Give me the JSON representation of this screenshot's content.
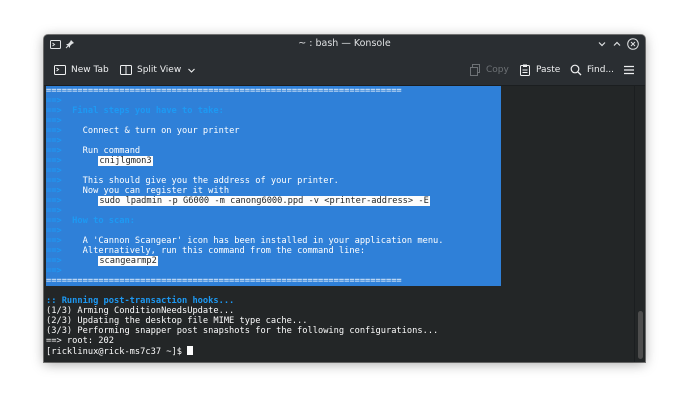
{
  "window": {
    "title": "~ : bash — Konsole"
  },
  "toolbar": {
    "new_tab": "New Tab",
    "split_view": "Split View",
    "copy": "Copy",
    "paste": "Paste",
    "find": "Find..."
  },
  "terminal": {
    "arrow": "==>",
    "banner_rule": "====================================================================",
    "lines": {
      "final_steps": "Final steps you have to take:",
      "connect": "Connect & turn on your printer",
      "run_command": "Run command",
      "cmd1": "cnijlgmon3",
      "should_give": "This should give you the address of your printer.",
      "now_register": "Now you can register it with",
      "cmd2": "sudo lpadmin -p G6000 -m canong6000.ppd -v <printer-address> -E",
      "how_to_scan": "How to scan:",
      "scangear_installed": "A 'Cannon Scangear' icon has been installed in your application menu.",
      "alternatively": "Alternatively, run this command from the command line:",
      "cmd3": "scangearmp2",
      "hooks": ":: Running post-transaction hooks...",
      "hook1": "(1/3) Arming ConditionNeedsUpdate...",
      "hook2": "(2/3) Updating the desktop file MIME type cache...",
      "hook3": "(3/3) Performing snapper post snapshots for the following configurations...",
      "root": "==> root: 202",
      "prompt": "[ricklinux@rick-ms7c37 ~]$ "
    }
  }
}
